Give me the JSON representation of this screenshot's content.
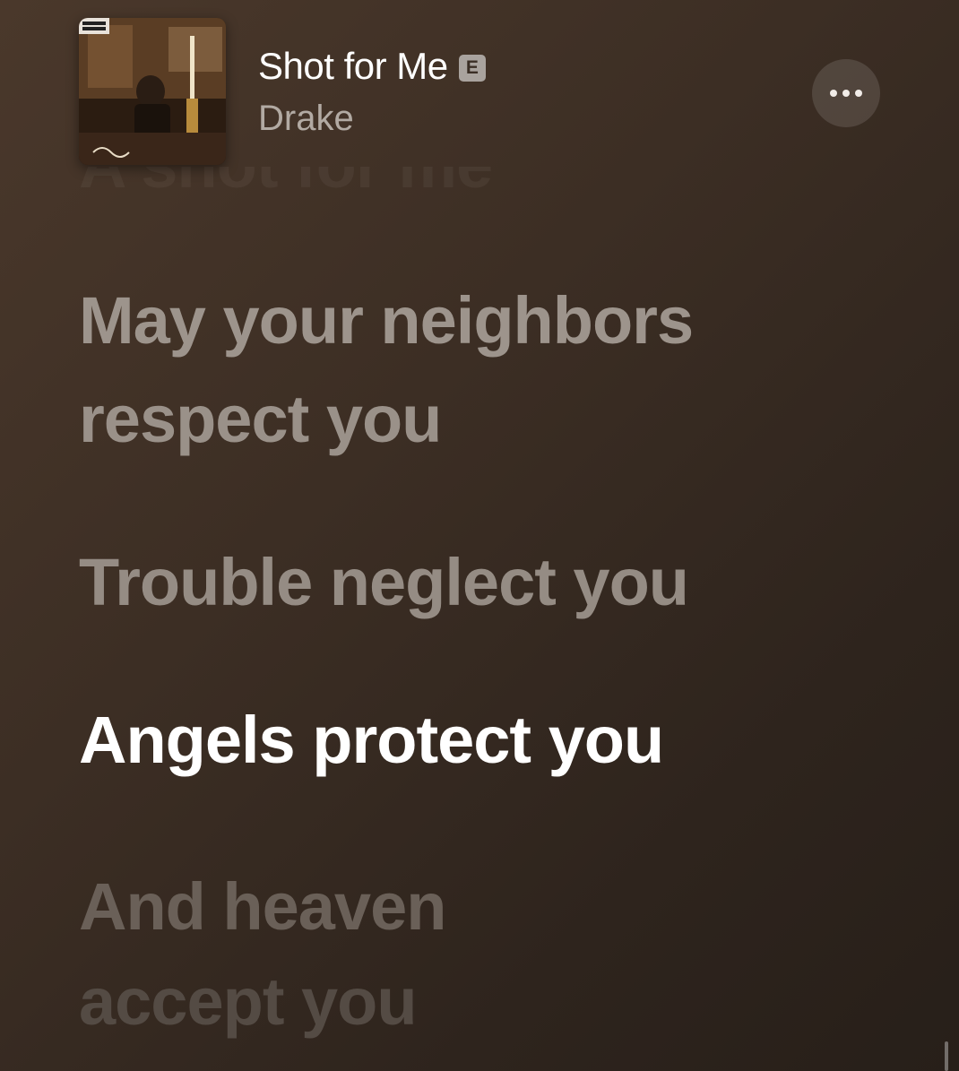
{
  "now_playing": {
    "title": "Shot for Me",
    "explicit_badge": "E",
    "artist": "Drake",
    "album_art_icon": "album-cover-take-care",
    "more_icon": "ellipsis-icon"
  },
  "lyrics": {
    "partial_previous_line": "A shot for me",
    "lines": [
      "May your neighbors",
      "respect you",
      "Trouble neglect you",
      "Angels protect you",
      "And heaven",
      "accept you"
    ],
    "active_line_index": 3
  },
  "colors": {
    "active_lyric": "#ffffff",
    "inactive_lyric": "#9d948c",
    "background": "#3c2e24"
  }
}
